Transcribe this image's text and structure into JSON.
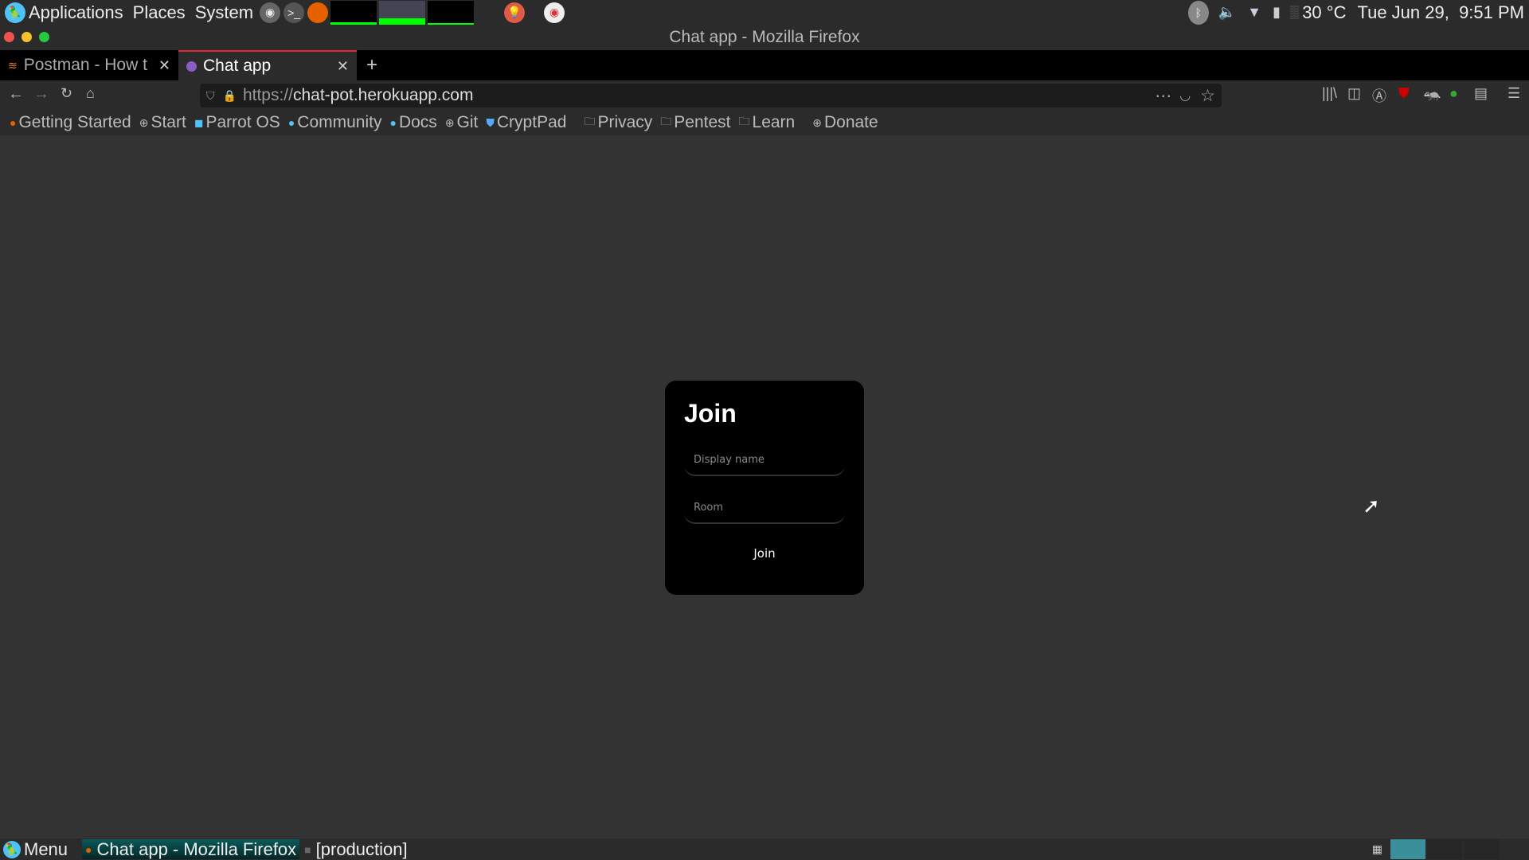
{
  "top_panel": {
    "menus": [
      "Applications",
      "Places",
      "System"
    ],
    "temperature": "30 °C",
    "clock": "Tue Jun 29,  9:51 PM"
  },
  "window": {
    "title": "Chat app - Mozilla Firefox"
  },
  "tabs": [
    {
      "label": "Postman - How t",
      "icon": "stackoverflow-icon"
    },
    {
      "label": "Chat app",
      "icon": "purple-dot-icon",
      "active": true
    }
  ],
  "url": {
    "scheme": "https://",
    "host": "chat-pot.herokuapp.com"
  },
  "bookmarks": [
    {
      "label": "Getting Started",
      "icon": "firefox-icon"
    },
    {
      "label": "Start",
      "icon": "globe-icon"
    },
    {
      "label": "Parrot OS",
      "icon": "parrot-icon"
    },
    {
      "label": "Community",
      "icon": "parrot-icon"
    },
    {
      "label": "Docs",
      "icon": "parrot-icon"
    },
    {
      "label": "Git",
      "icon": "globe-icon"
    },
    {
      "label": "CryptPad",
      "icon": "shield-icon"
    },
    {
      "label": "Privacy",
      "icon": "folder-icon"
    },
    {
      "label": "Pentest",
      "icon": "folder-icon"
    },
    {
      "label": "Learn",
      "icon": "folder-icon"
    },
    {
      "label": "Donate",
      "icon": "globe-icon"
    }
  ],
  "join_form": {
    "title": "Join",
    "display_name_placeholder": "Display name",
    "room_placeholder": "Room",
    "submit_label": "Join"
  },
  "bottom_panel": {
    "menu": "Menu",
    "tasks": [
      "Chat app - Mozilla Firefox",
      "[production]"
    ]
  },
  "colors": {
    "accent_tab": "#e0242f",
    "page_bg": "#333333",
    "card_bg": "#000000",
    "task_active": "#0a4f4f"
  }
}
